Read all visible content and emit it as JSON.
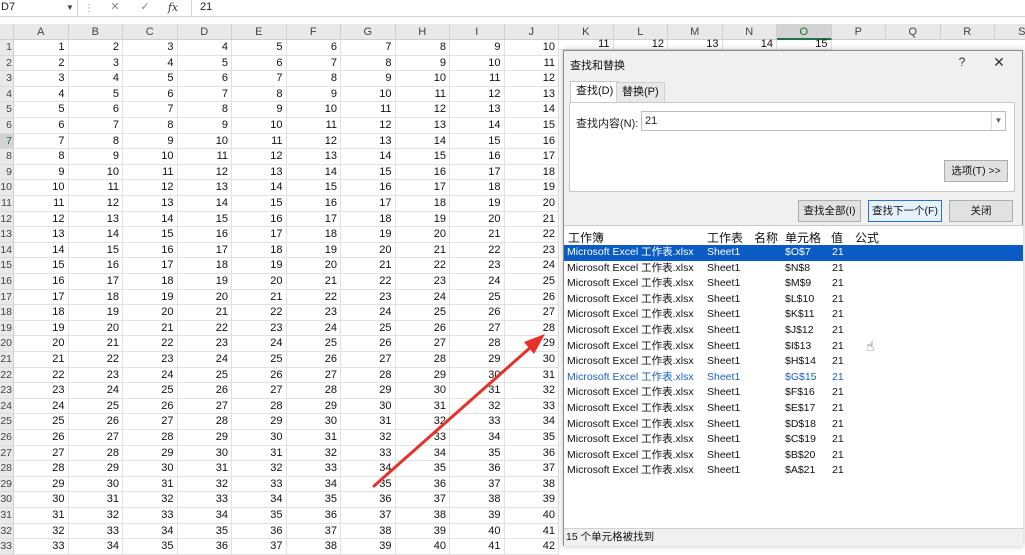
{
  "formula_bar": {
    "name_box": "D7",
    "cancel_icon": "✕",
    "enter_icon": "✓",
    "fx_label": "fx",
    "value": "21"
  },
  "sheet": {
    "columns": [
      "A",
      "B",
      "C",
      "D",
      "E",
      "F",
      "G",
      "H",
      "I",
      "J",
      "K",
      "L",
      "M",
      "N",
      "O",
      "P",
      "Q",
      "R",
      "S"
    ],
    "active_column": "O",
    "row_labels": [
      "1",
      "2",
      "3",
      "4",
      "5",
      "6",
      "7",
      "8",
      "9",
      "10",
      "11",
      "12",
      "13",
      "14",
      "15",
      "16",
      "17",
      "18",
      "19",
      "20",
      "21",
      "22",
      "23",
      "24",
      "25",
      "26",
      "27",
      "28",
      "29",
      "30",
      "31",
      "32",
      "33"
    ],
    "active_row": "7",
    "visible_cells_KO_row1": [
      "11",
      "12",
      "13",
      "14",
      "15"
    ]
  },
  "dialog": {
    "title": "查找和替换",
    "help": "?",
    "close": "✕",
    "tab_find": "查找(D)",
    "tab_replace": "替换(P)",
    "find_label": "查找内容(N):",
    "find_value": "21",
    "options_button": "选项(T) >>",
    "find_all_button": "查找全部(I)",
    "find_next_button": "查找下一个(F)",
    "close_button": "关闭",
    "result_headers": [
      "工作簿",
      "工作表",
      "名称",
      "单元格",
      "值",
      "公式"
    ],
    "results": [
      {
        "book": "Microsoft Excel 工作表.xlsx",
        "sheet": "Sheet1",
        "cell": "$O$7",
        "value": "21"
      },
      {
        "book": "Microsoft Excel 工作表.xlsx",
        "sheet": "Sheet1",
        "cell": "$N$8",
        "value": "21"
      },
      {
        "book": "Microsoft Excel 工作表.xlsx",
        "sheet": "Sheet1",
        "cell": "$M$9",
        "value": "21"
      },
      {
        "book": "Microsoft Excel 工作表.xlsx",
        "sheet": "Sheet1",
        "cell": "$L$10",
        "value": "21"
      },
      {
        "book": "Microsoft Excel 工作表.xlsx",
        "sheet": "Sheet1",
        "cell": "$K$11",
        "value": "21"
      },
      {
        "book": "Microsoft Excel 工作表.xlsx",
        "sheet": "Sheet1",
        "cell": "$J$12",
        "value": "21"
      },
      {
        "book": "Microsoft Excel 工作表.xlsx",
        "sheet": "Sheet1",
        "cell": "$I$13",
        "value": "21"
      },
      {
        "book": "Microsoft Excel 工作表.xlsx",
        "sheet": "Sheet1",
        "cell": "$H$14",
        "value": "21"
      },
      {
        "book": "Microsoft Excel 工作表.xlsx",
        "sheet": "Sheet1",
        "cell": "$G$15",
        "value": "21"
      },
      {
        "book": "Microsoft Excel 工作表.xlsx",
        "sheet": "Sheet1",
        "cell": "$F$16",
        "value": "21"
      },
      {
        "book": "Microsoft Excel 工作表.xlsx",
        "sheet": "Sheet1",
        "cell": "$E$17",
        "value": "21"
      },
      {
        "book": "Microsoft Excel 工作表.xlsx",
        "sheet": "Sheet1",
        "cell": "$D$18",
        "value": "21"
      },
      {
        "book": "Microsoft Excel 工作表.xlsx",
        "sheet": "Sheet1",
        "cell": "$C$19",
        "value": "21"
      },
      {
        "book": "Microsoft Excel 工作表.xlsx",
        "sheet": "Sheet1",
        "cell": "$B$20",
        "value": "21"
      },
      {
        "book": "Microsoft Excel 工作表.xlsx",
        "sheet": "Sheet1",
        "cell": "$A$21",
        "value": "21"
      }
    ],
    "selected_result": 0,
    "hover_result": 8,
    "status": "15 个单元格被找到"
  },
  "colors": {
    "selection_blue": "#0a5bc4",
    "annotation_red": "#e8302a",
    "excel_green": "#217346"
  },
  "icons": {
    "cursor": "hand-cursor-icon",
    "arrow": "red-annotation-arrow-icon"
  }
}
